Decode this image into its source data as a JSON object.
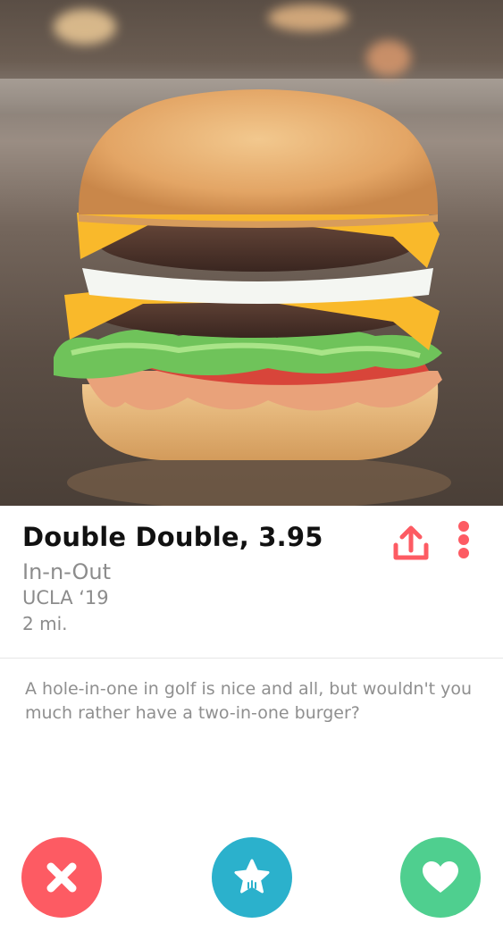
{
  "profile": {
    "title": "Double Double, 3.95",
    "line1": "In-n-Out",
    "line2": "UCLA ‘19",
    "line3": "2 mi.",
    "bio": "A hole-in-one in golf is nice and all, but wouldn't you much rather have a two-in-one burger?"
  },
  "icons": {
    "share": "share-icon",
    "more": "more-vertical-icon",
    "nope": "close-icon",
    "superlike": "star-icon",
    "like": "heart-icon"
  },
  "colors": {
    "accent": "#fd5b63",
    "superlike": "#2bb1cc",
    "like": "#4fcf8f"
  }
}
